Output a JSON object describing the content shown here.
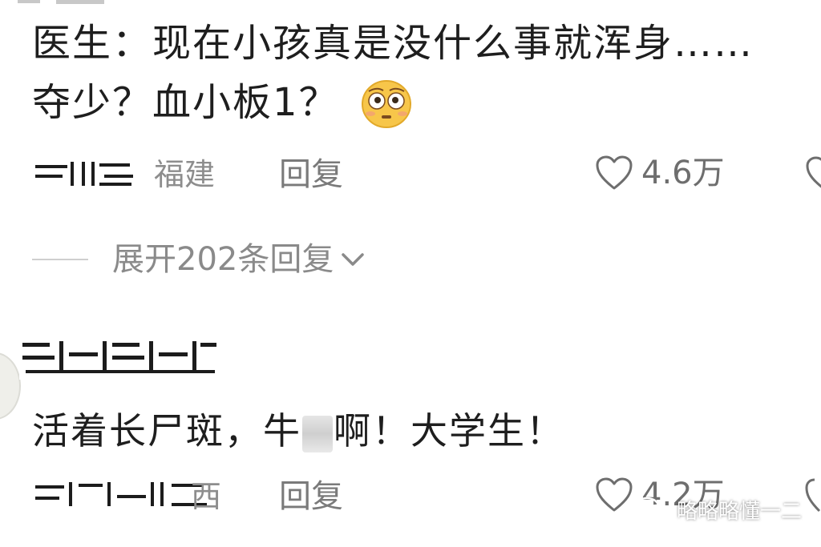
{
  "comments": [
    {
      "username": "",
      "text_line1": "医生：现在小孩真是没什么事就浑身……",
      "text_line2": "夺少？血小板1？",
      "emoji": "flushed-face-emoji",
      "location": "福建",
      "reply_label": "回复",
      "likes": "4.6万",
      "expand_label": "展开202条回复"
    },
    {
      "username": "",
      "text_pre": "活着长尸斑，牛",
      "text_post": "啊！大学生！",
      "location": "西",
      "reply_label": "回复",
      "likes": "4.2万"
    }
  ],
  "watermark": {
    "icon": "wechat-icon",
    "text": "略略略懂一二"
  },
  "colors": {
    "text": "#1e1e1e",
    "meta": "#8d8d8d",
    "background": "#ffffff"
  }
}
